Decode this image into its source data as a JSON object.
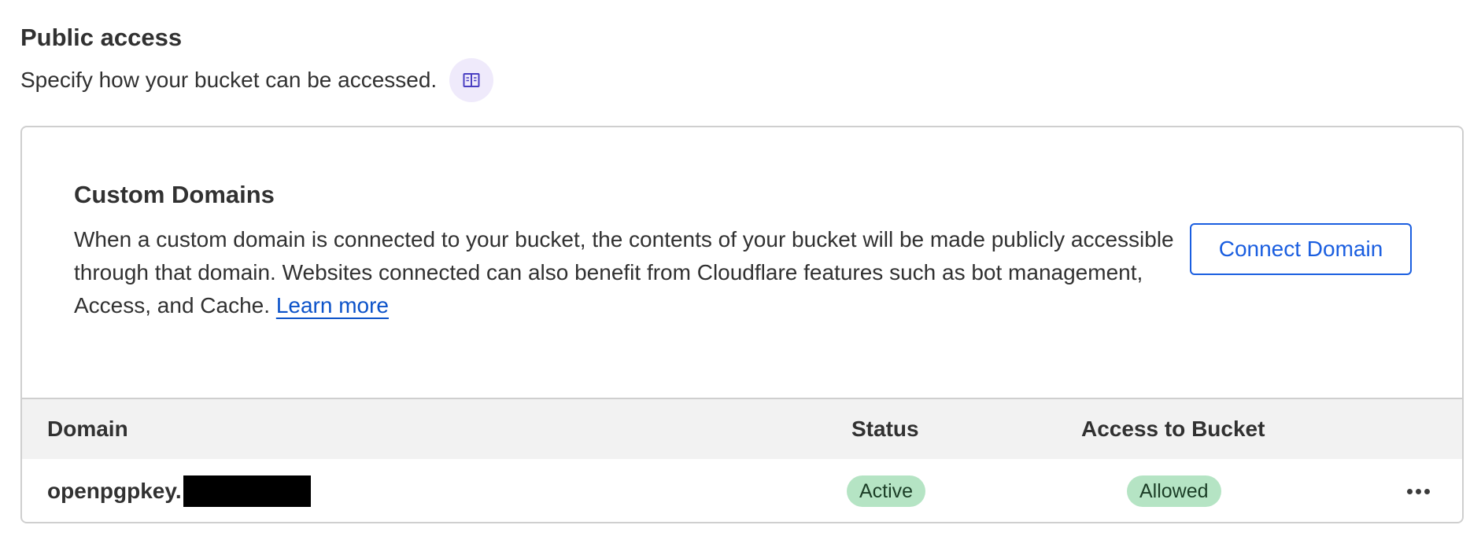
{
  "section": {
    "title": "Public access",
    "description": "Specify how your bucket can be accessed."
  },
  "custom_domains": {
    "title": "Custom Domains",
    "description": "When a custom domain is connected to your bucket, the contents of your bucket will be made publicly accessible through that domain. Websites connected can also benefit from Cloudflare features such as bot management, Access, and Cache.",
    "learn_more": "Learn more",
    "connect_button": "Connect Domain"
  },
  "table": {
    "headers": {
      "domain": "Domain",
      "status": "Status",
      "access": "Access to Bucket"
    },
    "rows": [
      {
        "domain": "openpgpkey.",
        "status": "Active",
        "access": "Allowed"
      }
    ]
  },
  "icons": {
    "docs": "book-icon",
    "row_actions": "more-horizontal-icon"
  },
  "colors": {
    "accent": "#1a5ee0",
    "link": "#0b52c9",
    "badge_bg": "#b5e4c4",
    "docs_button_bg": "#efeafb",
    "header_bg": "#f2f2f2"
  }
}
